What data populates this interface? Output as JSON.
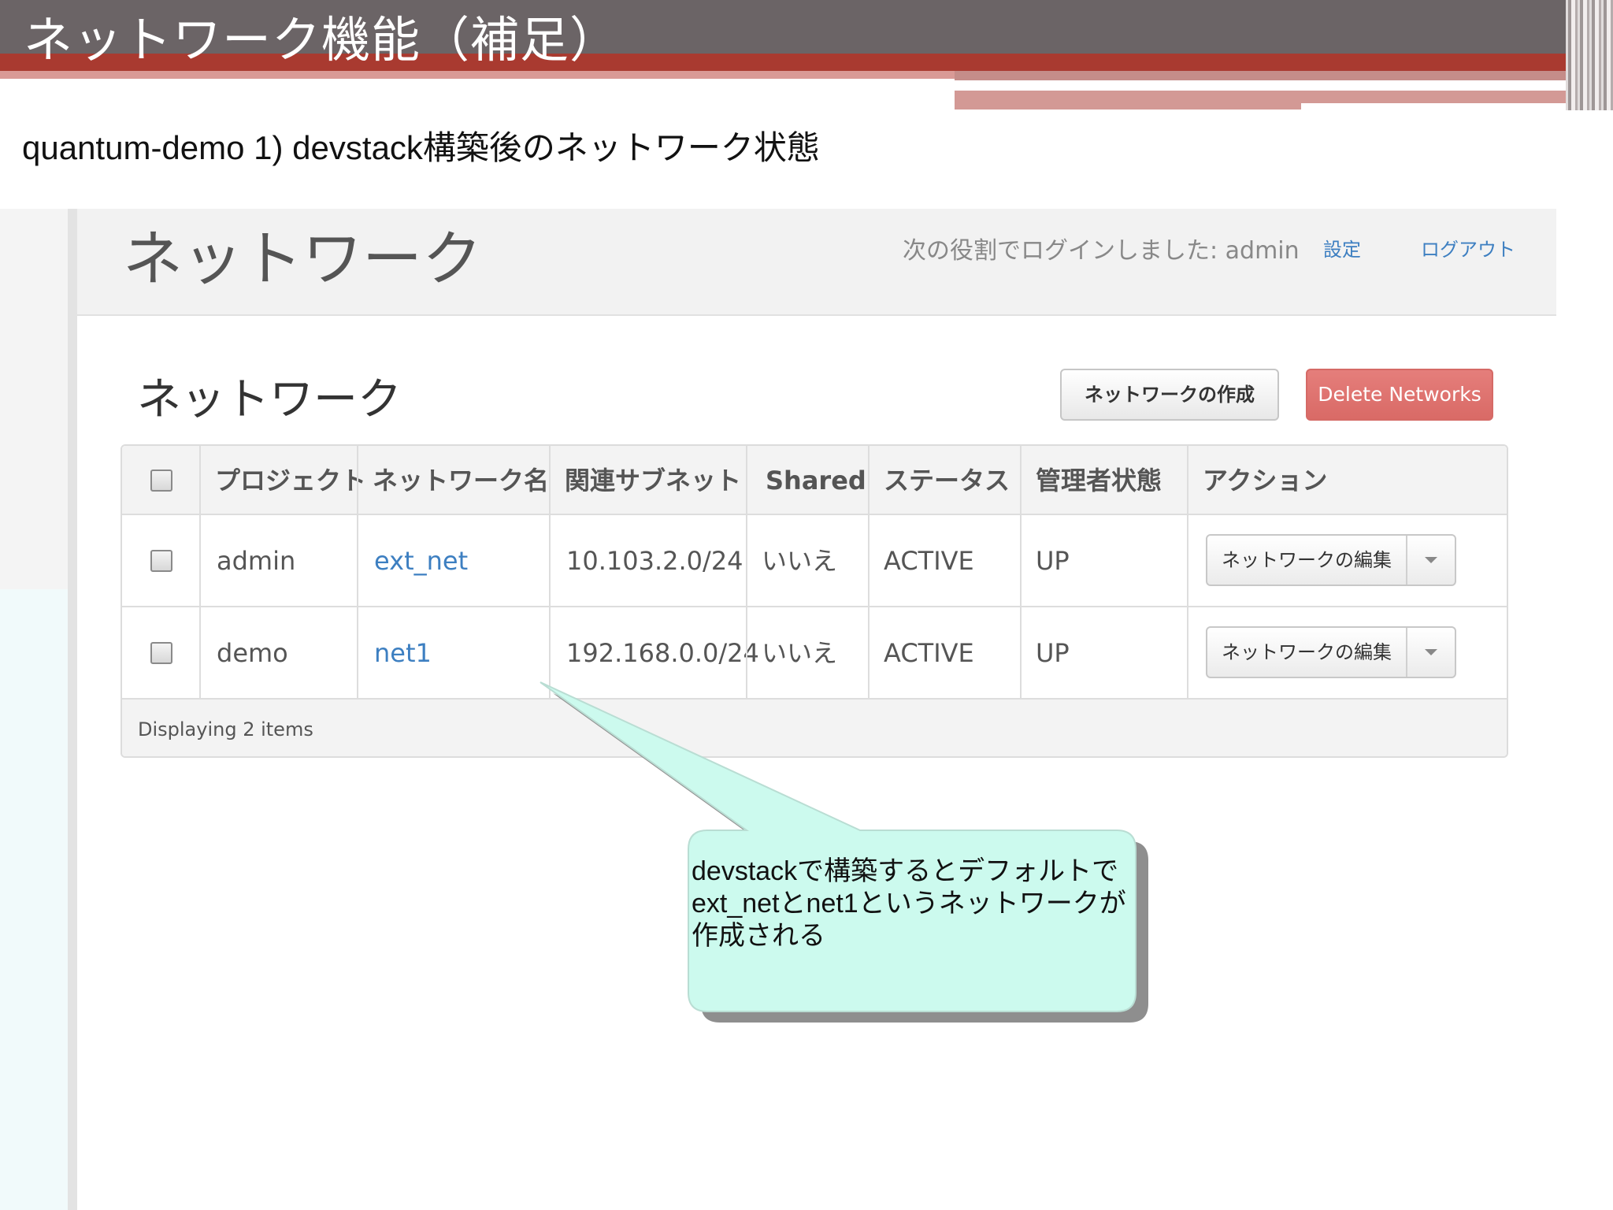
{
  "slide": {
    "title": "ネットワーク機能（補足）",
    "subtitle": "quantum-demo 1) devstack構築後のネットワーク状態"
  },
  "topbar": {
    "page_title": "ネットワーク",
    "login_text": "次の役割でログインしました: admin",
    "settings": "設定",
    "logout": "ログアウト"
  },
  "section": {
    "title": "ネットワーク",
    "create_button": "ネットワークの作成",
    "delete_button": "Delete Networks"
  },
  "table": {
    "headers": [
      "プロジェクト",
      "ネットワーク名",
      "関連サブネット",
      "Shared",
      "ステータス",
      "管理者状態",
      "アクション"
    ],
    "rows": [
      {
        "project": "admin",
        "name": "ext_net",
        "subnet": "10.103.2.0/24",
        "shared": "いいえ",
        "status": "ACTIVE",
        "admin_state": "UP",
        "action": "ネットワークの編集"
      },
      {
        "project": "demo",
        "name": "net1",
        "subnet": "192.168.0.0/24",
        "shared": "いいえ",
        "status": "ACTIVE",
        "admin_state": "UP",
        "action": "ネットワークの編集"
      }
    ],
    "footer": "Displaying 2 items"
  },
  "callout": {
    "lines": [
      "devstackで構築するとデフォルトで",
      "ext_netとnet1というネットワークが",
      "作成される"
    ],
    "fill_color": "#ccfaee"
  },
  "colors": {
    "link": "#3d7fc1",
    "delete_button": "#d96a66",
    "header_band": "#6b6466",
    "accent_red": "#a93a30"
  }
}
